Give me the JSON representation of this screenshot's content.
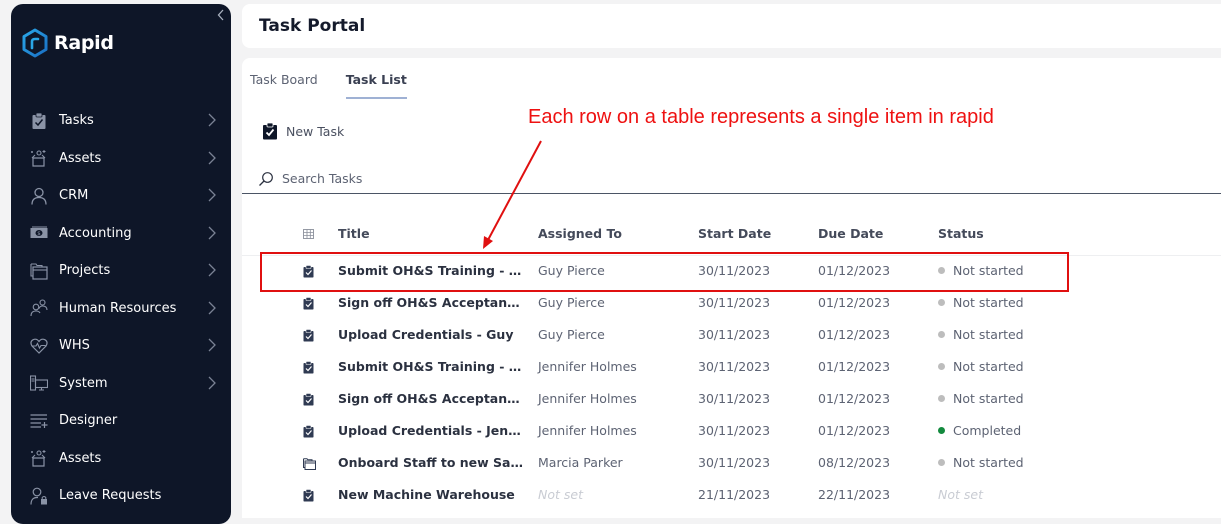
{
  "sidebar": {
    "brand": "Rapid",
    "collapse_icon": "chevron-left-icon",
    "items": [
      {
        "label": "Tasks",
        "icon": "clipboard-check-icon",
        "has_children": true
      },
      {
        "label": "Assets",
        "icon": "box-sparkle-icon",
        "has_children": true
      },
      {
        "label": "CRM",
        "icon": "person-icon",
        "has_children": true
      },
      {
        "label": "Accounting",
        "icon": "banknote-icon",
        "has_children": true
      },
      {
        "label": "Projects",
        "icon": "folders-icon",
        "has_children": true
      },
      {
        "label": "Human Resources",
        "icon": "people-icon",
        "has_children": true
      },
      {
        "label": "WHS",
        "icon": "heartbeat-icon",
        "has_children": true
      },
      {
        "label": "System",
        "icon": "computer-icon",
        "has_children": true
      },
      {
        "label": "Designer",
        "icon": "list-add-icon",
        "has_children": false
      },
      {
        "label": "Assets",
        "icon": "box-sparkle-icon",
        "has_children": false
      },
      {
        "label": "Leave Requests",
        "icon": "person-lock-icon",
        "has_children": false
      }
    ]
  },
  "header": {
    "title": "Task Portal"
  },
  "tabs": [
    {
      "label": "Task Board",
      "active": false
    },
    {
      "label": "Task List",
      "active": true
    }
  ],
  "toolbar": {
    "new_task_label": "New Task"
  },
  "search": {
    "placeholder": "Search Tasks",
    "value": ""
  },
  "table": {
    "columns": [
      "Title",
      "Assigned To",
      "Start Date",
      "Due Date",
      "Status"
    ],
    "rows": [
      {
        "type": "task",
        "title": "Submit OH&S Training - G...",
        "assigned": "Guy Pierce",
        "start": "30/11/2023",
        "due": "01/12/2023",
        "status": "Not started"
      },
      {
        "type": "task",
        "title": "Sign off OH&S Acceptance...",
        "assigned": "Guy Pierce",
        "start": "30/11/2023",
        "due": "01/12/2023",
        "status": "Not started"
      },
      {
        "type": "task",
        "title": "Upload Credentials - Guy",
        "assigned": "Guy Pierce",
        "start": "30/11/2023",
        "due": "01/12/2023",
        "status": "Not started"
      },
      {
        "type": "task",
        "title": "Submit OH&S Training - Je...",
        "assigned": "Jennifer Holmes",
        "start": "30/11/2023",
        "due": "01/12/2023",
        "status": "Not started"
      },
      {
        "type": "task",
        "title": "Sign off OH&S Acceptance...",
        "assigned": "Jennifer Holmes",
        "start": "30/11/2023",
        "due": "01/12/2023",
        "status": "Not started"
      },
      {
        "type": "task",
        "title": "Upload Credentials - Jenn...",
        "assigned": "Jennifer Holmes",
        "start": "30/11/2023",
        "due": "01/12/2023",
        "status": "Completed"
      },
      {
        "type": "project",
        "title": "Onboard Staff to new Safe...",
        "assigned": "Marcia Parker",
        "start": "30/11/2023",
        "due": "08/12/2023",
        "status": "Not started"
      },
      {
        "type": "task",
        "title": "New Machine Warehouse",
        "assigned": "Not set",
        "start": "21/11/2023",
        "due": "22/11/2023",
        "status": "Not set"
      }
    ]
  },
  "status_colors": {
    "Not started": "#bdbdbd",
    "Completed": "#138a3e"
  },
  "annotation": {
    "text": "Each row on a table represents a single item in rapid",
    "color": "#ee1111"
  }
}
